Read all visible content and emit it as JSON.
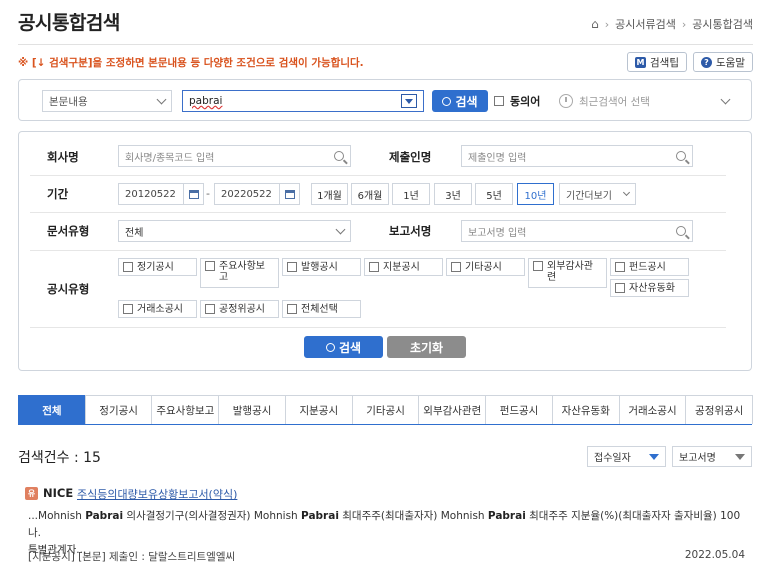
{
  "page": {
    "title": "공시통합검색"
  },
  "breadcrumb": {
    "item1": "공시서류검색",
    "item2": "공시통합검색"
  },
  "notice": "※ [↓ 검색구분]을 조정하면 본문내용 등 다양한 조건으로 검색이 가능합니다.",
  "help": {
    "tip_label": "검색팁",
    "help_label": "도움말"
  },
  "search": {
    "scope": "본문내용",
    "query": "pabrai",
    "button": "검색",
    "synonym_label": "동의어",
    "recent_placeholder": "최근검색어 선택"
  },
  "filters": {
    "company_label": "회사명",
    "company_placeholder": "회사명/종목코드 입력",
    "submitter_label": "제출인명",
    "submitter_placeholder": "제출인명 입력",
    "period_label": "기간",
    "date_from": "20120522",
    "date_to": "20220522",
    "periods": [
      "1개월",
      "6개월",
      "1년",
      "3년",
      "5년",
      "10년"
    ],
    "period_more": "기간더보기",
    "doctype_label": "문서유형",
    "doctype_value": "전체",
    "report_label": "보고서명",
    "report_placeholder": "보고서명 입력",
    "disclosure_label": "공시유형",
    "types": [
      "정기공시",
      "주요사항보고",
      "발행공시",
      "지분공시",
      "기타공시",
      "외부감사관련",
      "펀드공시",
      "자산유동화",
      "거래소공시",
      "공정위공시",
      "전체선택"
    ]
  },
  "actions": {
    "search": "검색",
    "reset": "초기화"
  },
  "tabs": [
    "전체",
    "정기공시",
    "주요사항보고",
    "발행공시",
    "지분공시",
    "기타공시",
    "외부감사관련",
    "펀드공시",
    "자산유동화",
    "거래소공시",
    "공정위공시"
  ],
  "results": {
    "count_label": "검색건수 : 15",
    "sort_by": "접수일자",
    "sort_field": "보고서명",
    "items": [
      {
        "badge": "유",
        "company": "NICE",
        "title": "주식등의대량보유상황보고서(약식)",
        "snippet_1": "...Mohnish ",
        "snippet_2": "Pabrai",
        "snippet_3": " 의사결정기구(의사결정권자) Mohnish ",
        "snippet_4": "Pabrai",
        "snippet_5": " 최대주주(최대출자자) Mohnish ",
        "snippet_6": "Pabrai",
        "snippet_7": " 최대주주 지분율(%)(최대출자자 출자비율) 100 나.",
        "snippet_8": "특별관계자...",
        "meta": "[지분공시] [본문] 제출인 : 달랄스트리트엘엘씨",
        "date": "2022.05.04"
      }
    ]
  }
}
